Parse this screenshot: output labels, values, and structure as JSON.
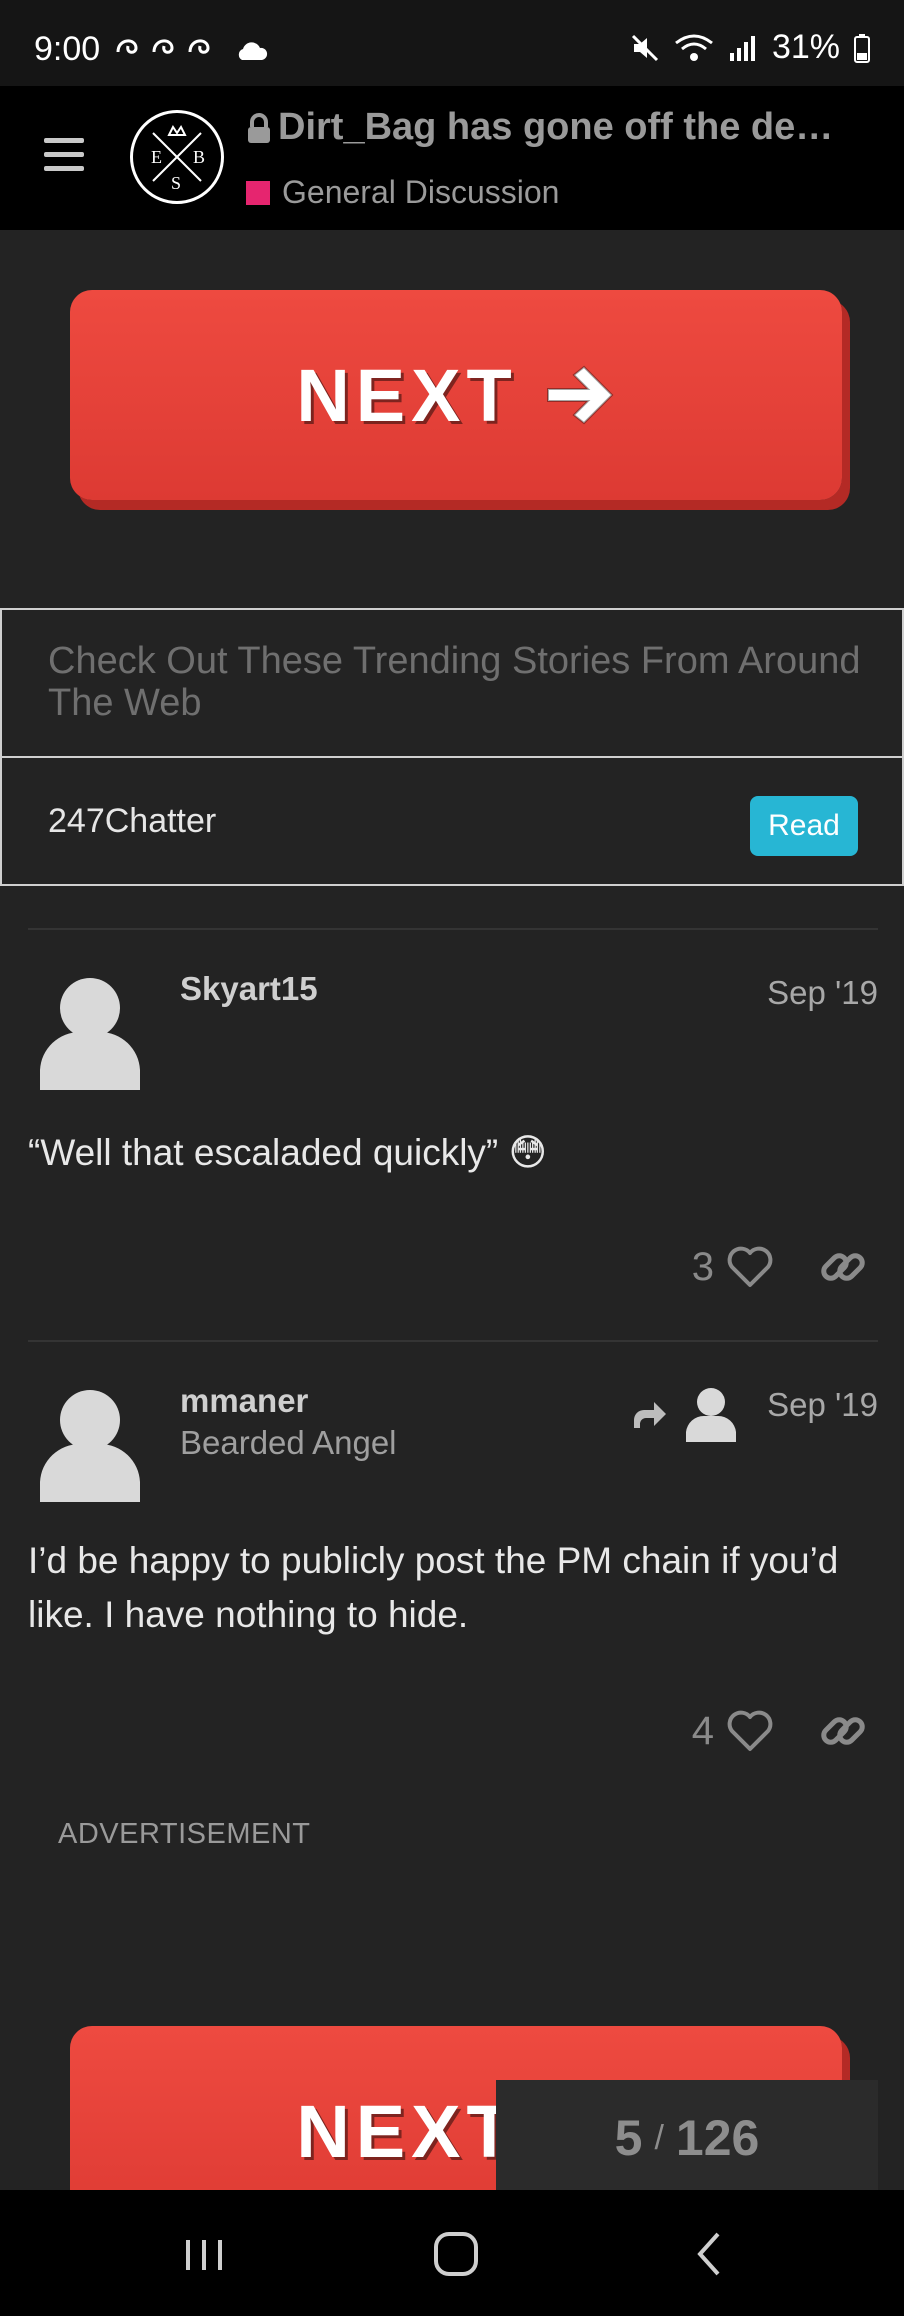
{
  "status_bar": {
    "time": "9:00",
    "battery": "31%"
  },
  "header": {
    "title": "Dirt_Bag has gone off the de…",
    "category": "General Discussion",
    "category_color": "#e6256f",
    "logo_letters": [
      "E",
      "B",
      "S"
    ]
  },
  "next_button": {
    "label": "NEXT"
  },
  "trending": {
    "heading": "Check Out These Trending Stories From Around The Web",
    "source": "247Chatter",
    "read_label": "Read",
    "read_color": "#27b6d4"
  },
  "posts": [
    {
      "username": "Skyart15",
      "date": "Sep '19",
      "body": "“Well that escaladed quickly” 😳",
      "likes": "3"
    },
    {
      "username": "mmaner",
      "user_title": "Bearded Angel",
      "date": "Sep '19",
      "body": "I’d be happy to publicly post the PM chain if you’d like. I have nothing to hide.",
      "likes": "4"
    }
  ],
  "advertisement_label": "ADVERTISEMENT",
  "progress": {
    "current": "5",
    "separator": "/",
    "total": "126"
  },
  "accent_red": "#e5433b"
}
